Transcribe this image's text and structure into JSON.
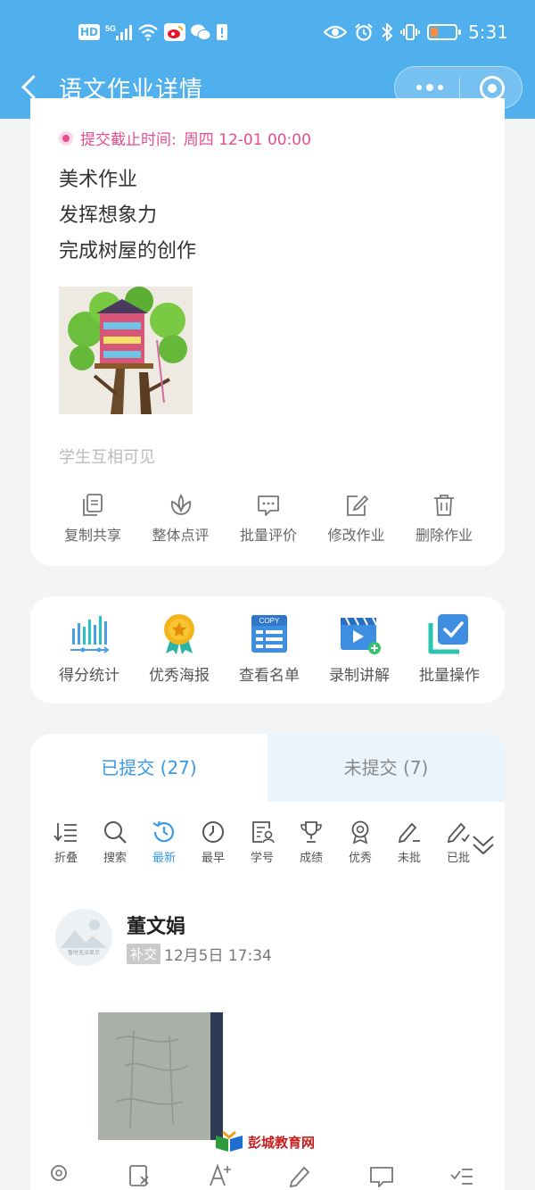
{
  "status_bar": {
    "hd": "HD",
    "signal": "5G",
    "time": "5:31"
  },
  "nav": {
    "title": "语文作业详情"
  },
  "assignment": {
    "deadline_label": "提交截止时间:",
    "deadline_value": "周四 12-01 00:00",
    "lines": [
      "美术作业",
      "发挥想象力",
      "完成树屋的创作"
    ],
    "visibility_note": "学生互相可见",
    "actions": [
      {
        "label": "复制共享",
        "icon": "copy-icon"
      },
      {
        "label": "整体点评",
        "icon": "lotus-icon"
      },
      {
        "label": "批量评价",
        "icon": "comment-icon"
      },
      {
        "label": "修改作业",
        "icon": "edit-icon"
      },
      {
        "label": "删除作业",
        "icon": "trash-icon"
      }
    ]
  },
  "tools": [
    {
      "label": "得分统计",
      "icon": "bar-chart-icon"
    },
    {
      "label": "优秀海报",
      "icon": "medal-icon"
    },
    {
      "label": "查看名单",
      "icon": "copy-list-icon"
    },
    {
      "label": "录制讲解",
      "icon": "video-icon"
    },
    {
      "label": "批量操作",
      "icon": "checkbox-icon"
    }
  ],
  "tabs": {
    "submitted": "已提交 (27)",
    "not_submitted": "未提交 (7)"
  },
  "filters": [
    {
      "label": "折叠",
      "icon": "collapse-icon"
    },
    {
      "label": "搜索",
      "icon": "search-icon"
    },
    {
      "label": "最新",
      "icon": "clock-back-icon",
      "active": true
    },
    {
      "label": "最早",
      "icon": "clock-icon"
    },
    {
      "label": "学号",
      "icon": "id-card-icon"
    },
    {
      "label": "成绩",
      "icon": "trophy-icon"
    },
    {
      "label": "优秀",
      "icon": "badge-icon"
    },
    {
      "label": "未批",
      "icon": "pen-icon"
    },
    {
      "label": "已批",
      "icon": "pen-check-icon"
    }
  ],
  "submission": {
    "student_name": "董文娟",
    "tag": "补交",
    "time": "12月5日 17:34",
    "avatar_caption": "暂时无法显示"
  },
  "watermark": "彭城教育网",
  "colors": {
    "primary": "#50b0ee",
    "accent": "#3a9ae6",
    "deadline": "#e64d8f"
  }
}
